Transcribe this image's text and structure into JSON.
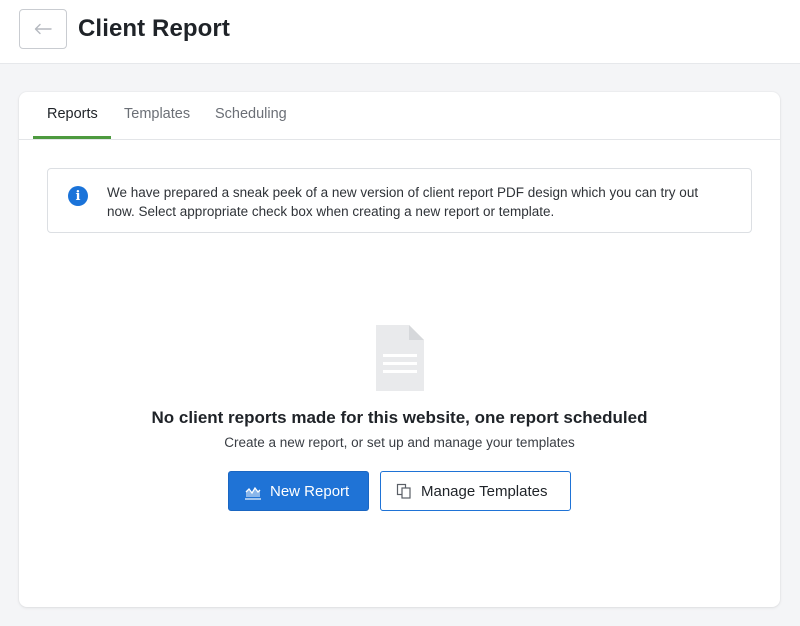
{
  "header": {
    "title": "Client Report",
    "back_icon": "arrow-left-icon"
  },
  "tabs": [
    {
      "label": "Reports",
      "active": true
    },
    {
      "label": "Templates",
      "active": false
    },
    {
      "label": "Scheduling",
      "active": false
    }
  ],
  "info": {
    "icon": "info-icon",
    "text_line1": "We have prepared a sneak peek of a new version of client report PDF design which you can try out",
    "text_line2": "now. Select appropriate check box when creating a new report or template."
  },
  "empty_state": {
    "icon": "document-icon",
    "title": "No client reports made for this website, one report scheduled",
    "subtitle": "Create a new report, or set up and manage your templates"
  },
  "actions": {
    "new_report_label": "New Report",
    "new_report_icon": "chart-icon",
    "manage_templates_label": "Manage Templates",
    "manage_templates_icon": "copy-icon"
  },
  "colors": {
    "accent": "#1f73d6",
    "tab_underline": "#4d9a3f",
    "info_icon": "#1a73d9"
  }
}
